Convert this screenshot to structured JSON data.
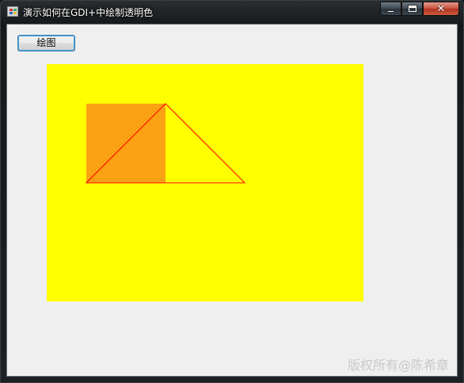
{
  "window": {
    "title": "演示如何在GDI+中绘制透明色",
    "caption_buttons": {
      "minimize_icon": "minimize-icon",
      "maximize_icon": "maximize-icon",
      "close_label": "✕"
    }
  },
  "toolbar": {
    "draw_button_label": "绘图"
  },
  "canvas": {
    "background_color": "#ffff00",
    "square_fill_color": "#fba213",
    "triangle_stroke_color": "#ff0000"
  },
  "watermark": {
    "text": "版权所有@陈希章"
  }
}
